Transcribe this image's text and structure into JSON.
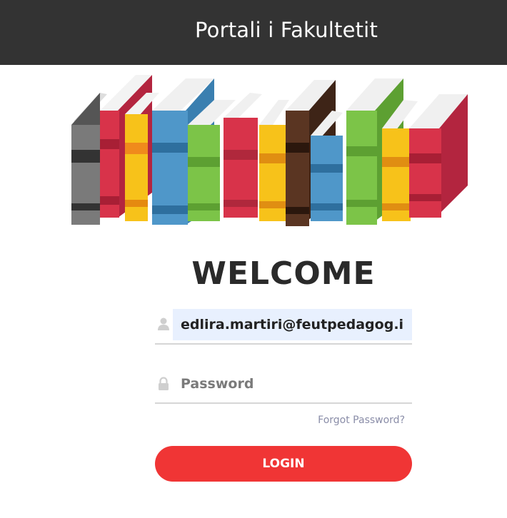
{
  "header": {
    "title": "Portali i Fakultetit"
  },
  "main": {
    "welcome": "WELCOME",
    "email_value": "edlira.martiri@feutpedagog.info",
    "password_placeholder": "Password",
    "forgot_label": "Forgot Password?",
    "login_label": "LOGIN"
  },
  "icons": {
    "user": "user-icon",
    "lock": "lock-icon"
  },
  "colors": {
    "header_bg": "#333333",
    "login_button": "#f03535",
    "autofill_bg": "#e8f0fe",
    "forgot_link": "#8a8da8"
  }
}
